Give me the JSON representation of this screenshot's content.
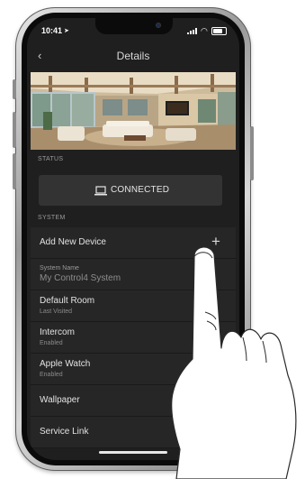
{
  "status_bar": {
    "time": "10:41"
  },
  "nav": {
    "title": "Details"
  },
  "status_section": {
    "label": "STATUS",
    "connection_label": "CONNECTED"
  },
  "system_section": {
    "label": "SYSTEM",
    "items": [
      {
        "label": "Add New Device"
      },
      {
        "field_label": "System Name",
        "value": "My Control4 System"
      },
      {
        "label": "Default Room",
        "sub": "Last Visited"
      },
      {
        "label": "Intercom",
        "sub": "Enabled"
      },
      {
        "label": "Apple Watch",
        "sub": "Enabled"
      },
      {
        "label": "Wallpaper"
      },
      {
        "label": "Service Link"
      }
    ]
  }
}
